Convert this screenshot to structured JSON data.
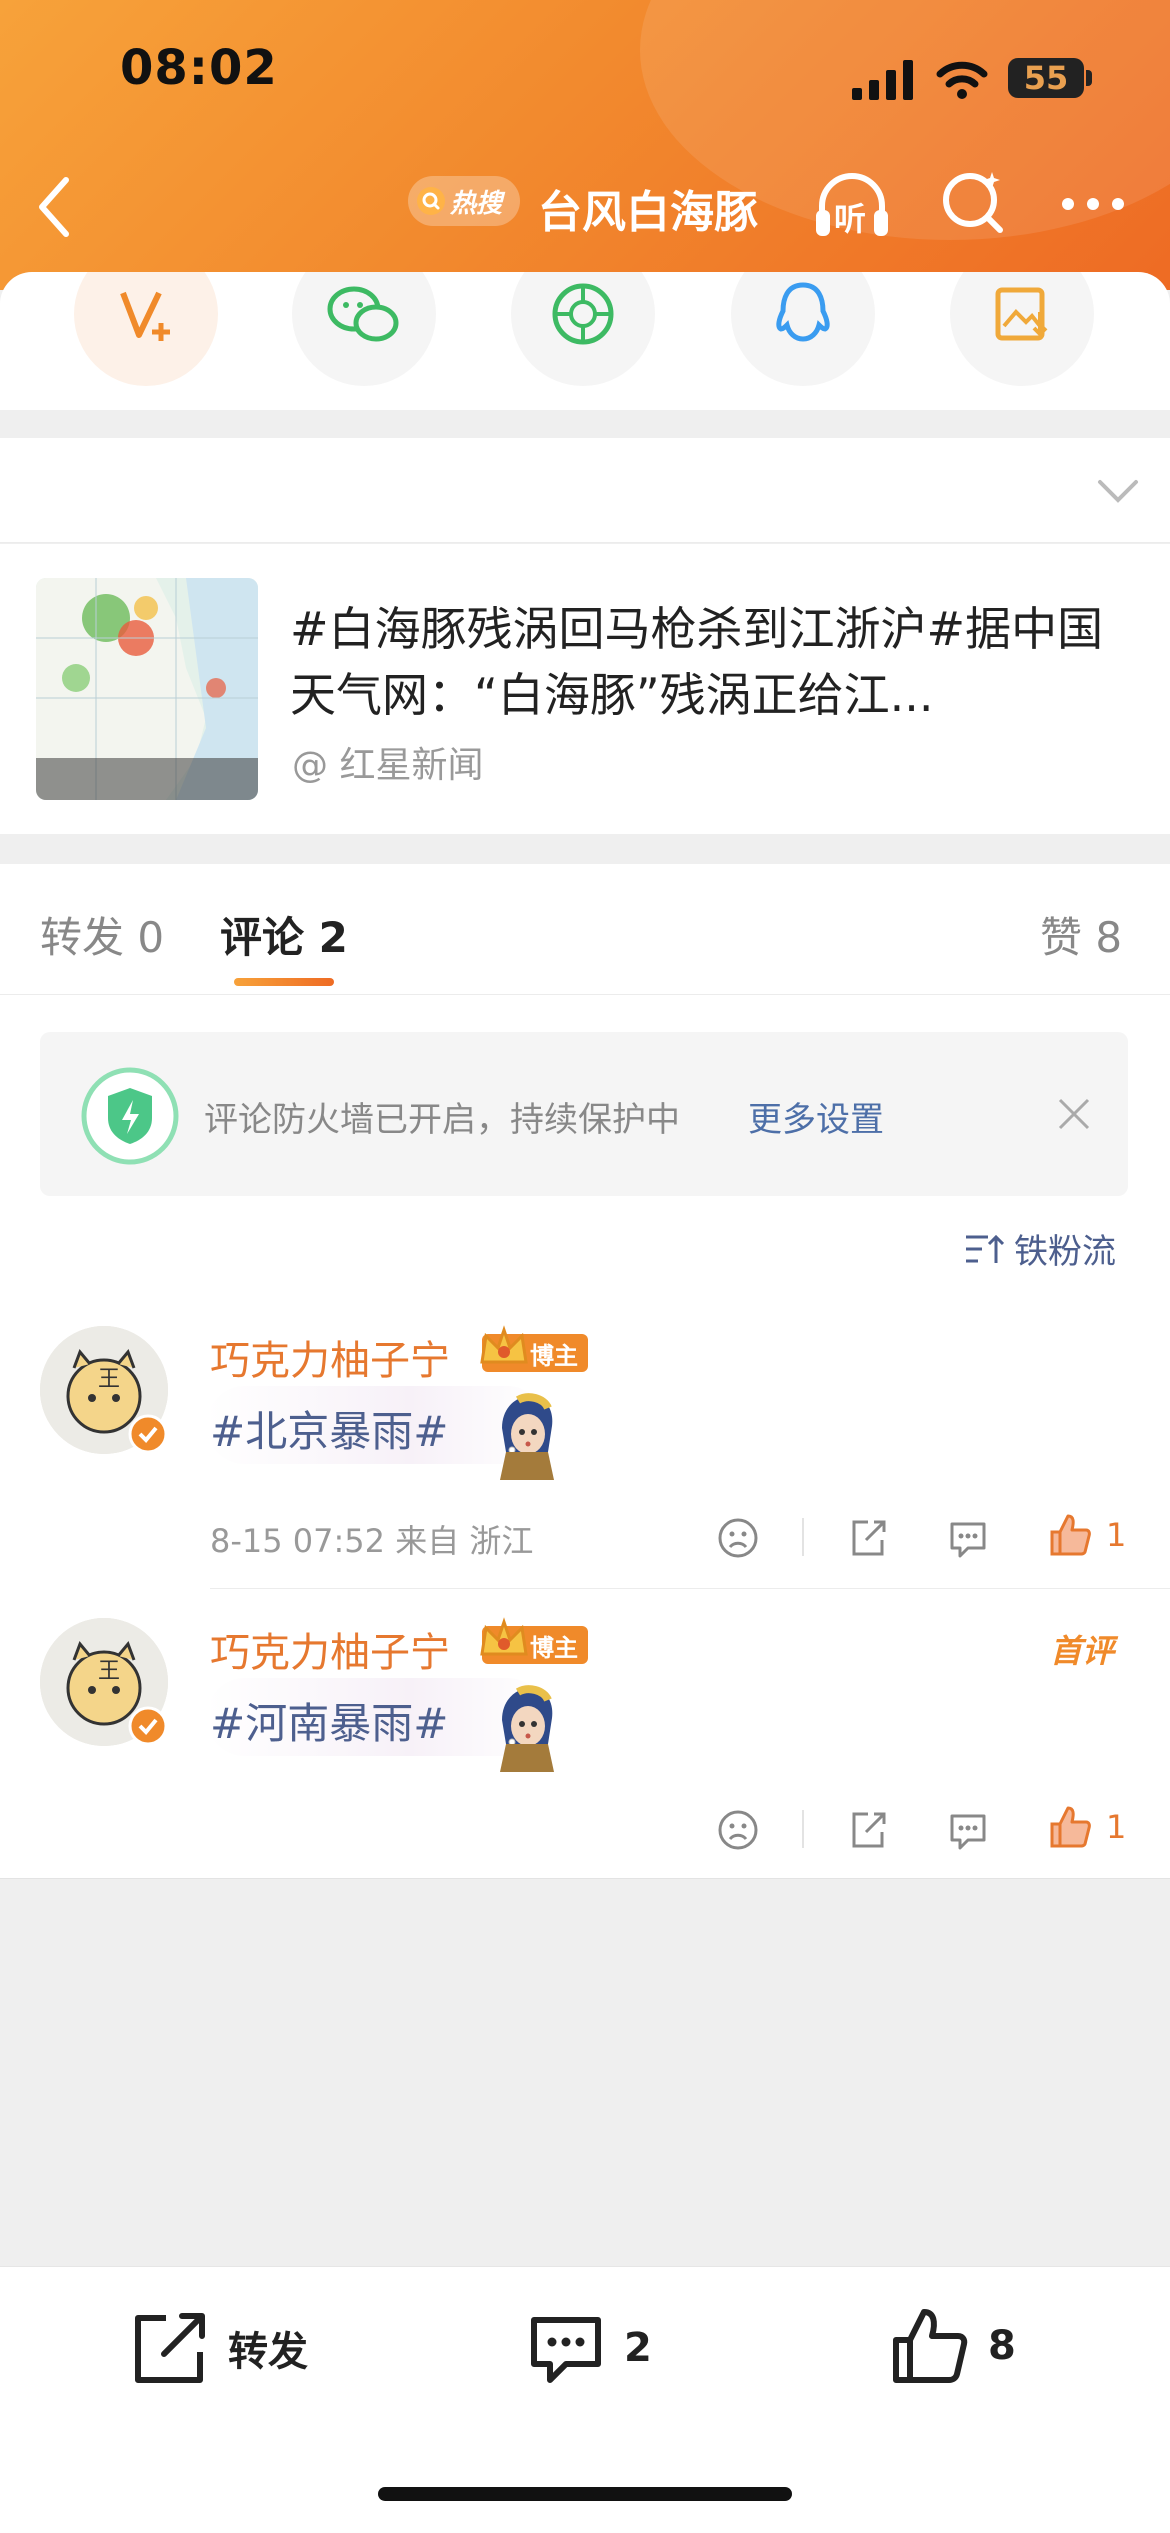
{
  "status_bar": {
    "time": "08:02",
    "battery": "55"
  },
  "nav": {
    "hot_badge": "热搜",
    "title": "台风白海豚",
    "listen_label": "听"
  },
  "share_sheet": {
    "items": [
      "vplus-icon",
      "wechat-icon",
      "moments-icon",
      "qq-icon",
      "save-image-icon"
    ]
  },
  "post": {
    "text": "#白海豚残涡回马枪杀到江浙沪#据中国天气网：“白海豚”残涡正给江...",
    "source": "@ 红星新闻"
  },
  "tabs": {
    "repost": "转发 0",
    "comment": "评论 2",
    "like": "赞 8"
  },
  "firewall": {
    "text": "评论防火墙已开启，持续保护中",
    "link": "更多设置"
  },
  "sort": {
    "label": "铁粉流"
  },
  "comments": [
    {
      "username": "巧克力柚子宁",
      "badge": "博主",
      "text": "#北京暴雨#",
      "meta": "8-15 07:52 来自 浙江",
      "likes": "1"
    },
    {
      "username": "巧克力柚子宁",
      "badge": "博主",
      "text": "#河南暴雨#",
      "first_label": "首评",
      "likes": "1"
    }
  ],
  "bottom_bar": {
    "repost": "转发",
    "comment_count": "2",
    "like_count": "8"
  },
  "colors": {
    "header_start": "#f7a23a",
    "header_end": "#ee6b24",
    "accent": "#e6782f",
    "topic": "#4d5f8e",
    "link": "#4d6fa8"
  }
}
